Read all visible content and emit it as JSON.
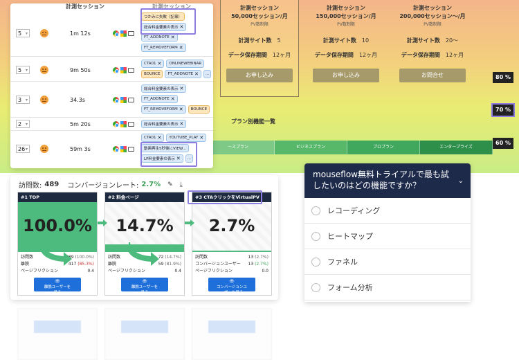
{
  "heatmap": {
    "plans": [
      {
        "title": "計測セッション",
        "sessions": "50,000セッション/月",
        "pv": "PV数制限",
        "sites_label": "計測サイト数",
        "sites": "5",
        "storage_label": "データ保存期間",
        "storage": "12ヶ月",
        "button": "お申し込み"
      },
      {
        "title": "計測セッション",
        "sessions": "150,000セッション/月",
        "pv": "PV数制限",
        "sites_label": "計測サイト数",
        "sites": "10",
        "storage_label": "データ保存期間",
        "storage": "12ヶ月",
        "button": "お申し込み"
      },
      {
        "title": "計測セッション",
        "sessions": "200,000セッション〜/月",
        "pv": "PV数制限",
        "sites_label": "計測サイト数",
        "sites": "20〜",
        "storage_label": "データ保存期間",
        "storage": "12ヶ月",
        "button": "お問合せ"
      }
    ],
    "percentages": [
      "80 %",
      "70 %",
      "60 %"
    ],
    "plan_list_title": "プラン別機能一覧",
    "plan_tabs": [
      "ースプラン",
      "ビジネスプラン",
      "プロプラン",
      "エンタープライズ"
    ]
  },
  "sessions": {
    "header_title": "計測セッション",
    "header_title2": "計測セッション",
    "rows": [
      {
        "pages": "5",
        "duration": "1m 12s",
        "tags": [
          {
            "label": "つかみに失敗（記事）",
            "style": "o",
            "x": false
          },
          {
            "label": "総合料金要素の表示",
            "style": "b",
            "x": true
          },
          {
            "label": "FT_ADDNOTE",
            "style": "b",
            "x": true
          },
          {
            "label": "FT_REMOVEFORM",
            "style": "b",
            "x": true
          }
        ]
      },
      {
        "pages": "5",
        "duration": "9m 50s",
        "tags": [
          {
            "label": "CTA01",
            "style": "b",
            "x": true
          },
          {
            "label": "ONLINEWEBINAR",
            "style": "b",
            "x": false
          },
          {
            "label": "BOUNCE",
            "style": "o",
            "x": false
          },
          {
            "label": "FT_ADDNOTE",
            "style": "b",
            "x": true
          },
          {
            "label": "...",
            "style": "b",
            "x": false
          }
        ]
      },
      {
        "pages": "3",
        "duration": "34.3s",
        "tags": [
          {
            "label": "総合料金要素の表示",
            "style": "b",
            "x": true
          },
          {
            "label": "FT_ADDNOTE",
            "style": "b",
            "x": true
          },
          {
            "label": "FT_REMOVEFORM",
            "style": "b",
            "x": true
          },
          {
            "label": "BOUNCE",
            "style": "o",
            "x": false
          }
        ]
      },
      {
        "pages": "2",
        "duration": "5m 20s",
        "tags": [
          {
            "label": "総合料金要素の表示",
            "style": "b",
            "x": true
          }
        ]
      },
      {
        "pages": "26",
        "duration": "59m 3s",
        "tags": [
          {
            "label": "CTA01",
            "style": "b",
            "x": true
          },
          {
            "label": "YOUTUBE_PLAY",
            "style": "b",
            "x": true
          },
          {
            "label": "動画再生5秒後にVIEW...",
            "style": "b",
            "x": false
          },
          {
            "label": "LP料金要素の表示",
            "style": "b",
            "x": true
          },
          {
            "label": "...",
            "style": "b",
            "x": false
          }
        ]
      }
    ]
  },
  "funnel": {
    "visits_label": "訪問数:",
    "visits": "489",
    "conv_label": "コンバージョンレート:",
    "conv": "2.7%",
    "steps": [
      {
        "name": "#1  TOP",
        "percent": "100.0%",
        "fill": 1.0,
        "stats": [
          {
            "label": "訪問数",
            "value": "489",
            "pct": "(100.0%)",
            "cls": "pd"
          },
          {
            "label": "離脱",
            "value": "417",
            "pct": "(85.3%)",
            "cls": "pr"
          },
          {
            "label": "ページフリクション",
            "value": "0.4",
            "pct": "",
            "cls": "pd"
          }
        ],
        "button": [
          "離脱ユーザーを",
          "見る"
        ]
      },
      {
        "name": "#2  料金ページ",
        "percent": "14.7%",
        "fill": 0.147,
        "stats": [
          {
            "label": "訪問数",
            "value": "72",
            "pct": "(14.7%)",
            "cls": "pd"
          },
          {
            "label": "離脱",
            "value": "59",
            "pct": "(81.9%)",
            "cls": "pd"
          },
          {
            "label": "ページフリクション",
            "value": "0.4",
            "pct": "",
            "cls": "pd"
          }
        ],
        "button": [
          "離脱ユーザーを",
          "見る"
        ]
      },
      {
        "name": "#3  CTAクリックをVirtualPV",
        "percent": "2.7%",
        "fill": 0.027,
        "stats": [
          {
            "label": "訪問数",
            "value": "13",
            "pct": "(2.7%)",
            "cls": "pd"
          },
          {
            "label": "コンバージョンユーザー",
            "value": "13",
            "pct": "(2.7%)",
            "cls": "pg"
          },
          {
            "label": "ページフリクション",
            "value": "0.0",
            "pct": "",
            "cls": "pd"
          }
        ],
        "button": [
          "コンバージョンユ",
          "ーザーを見る"
        ]
      }
    ]
  },
  "survey": {
    "question": "mouseflow無料トライアルで最も試したいのはどの機能ですか？",
    "options": [
      "レコーディング",
      "ヒートマップ",
      "ファネル",
      "フォーム分析"
    ]
  }
}
